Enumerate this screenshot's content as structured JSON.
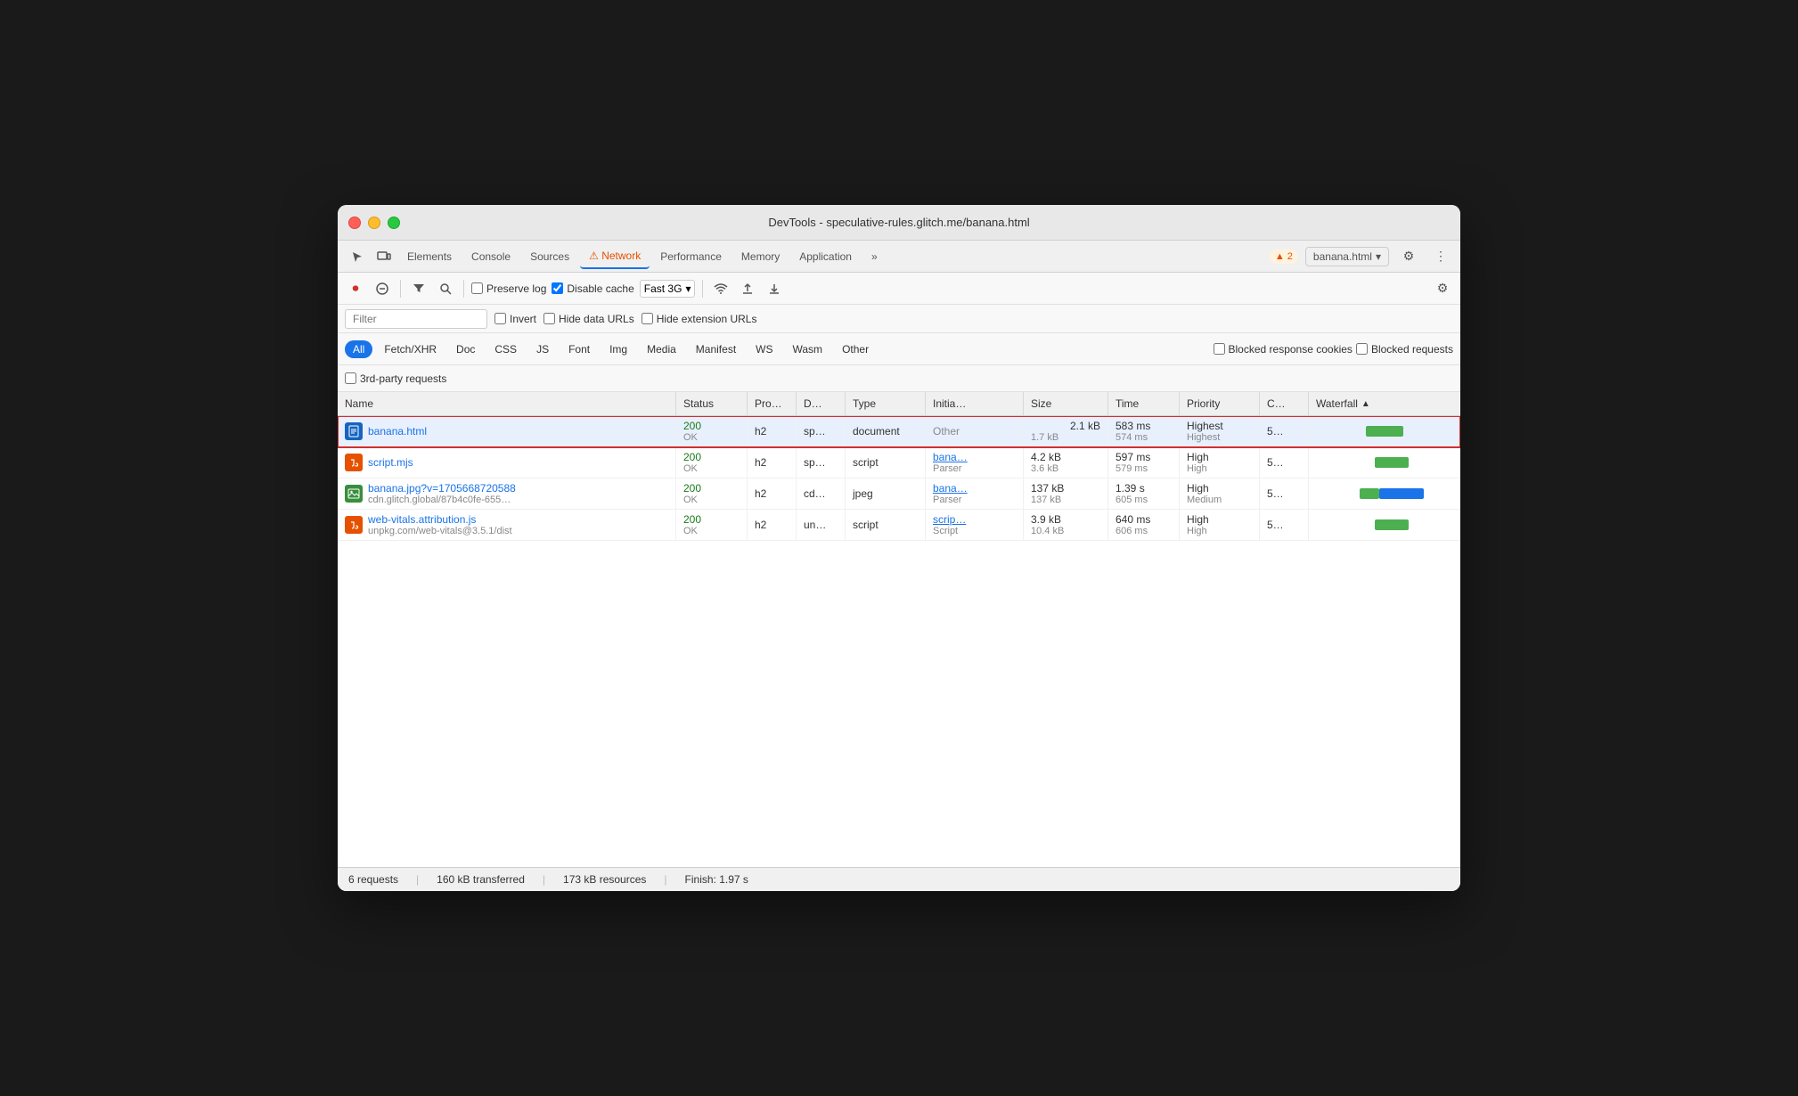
{
  "window": {
    "title": "DevTools - speculative-rules.glitch.me/banana.html"
  },
  "tabs": {
    "items": [
      {
        "label": "Elements",
        "active": false
      },
      {
        "label": "Console",
        "active": false
      },
      {
        "label": "Sources",
        "active": false
      },
      {
        "label": "⚠ Network",
        "active": true
      },
      {
        "label": "Performance",
        "active": false
      },
      {
        "label": "Memory",
        "active": false
      },
      {
        "label": "Application",
        "active": false
      },
      {
        "label": "»",
        "active": false
      }
    ],
    "warning_count": "▲ 2",
    "active_page": "banana.html",
    "settings_icon": "⚙",
    "more_icon": "⋮"
  },
  "toolbar": {
    "record_icon": "⏺",
    "clear_icon": "🚫",
    "filter_icon": "▼",
    "search_icon": "🔍",
    "preserve_log_label": "Preserve log",
    "disable_cache_label": "Disable cache",
    "network_throttle": "Fast 3G",
    "wifi_icon": "wifi",
    "upload_icon": "↑",
    "download_icon": "↓",
    "settings_icon": "⚙"
  },
  "filter": {
    "placeholder": "Filter",
    "invert_label": "Invert",
    "hide_data_urls_label": "Hide data URLs",
    "hide_ext_urls_label": "Hide extension URLs"
  },
  "type_filters": {
    "items": [
      "All",
      "Fetch/XHR",
      "Doc",
      "CSS",
      "JS",
      "Font",
      "Img",
      "Media",
      "Manifest",
      "WS",
      "Wasm",
      "Other"
    ],
    "active": "All",
    "blocked_response_cookies": "Blocked response cookies",
    "blocked_requests": "Blocked requests"
  },
  "third_party": {
    "label": "3rd-party requests"
  },
  "table": {
    "columns": [
      "Name",
      "Status",
      "Pro…",
      "D…",
      "Type",
      "Initia…",
      "Size",
      "Time",
      "Priority",
      "C…",
      "Waterfall"
    ],
    "rows": [
      {
        "name": "banana.html",
        "sub": "",
        "icon_type": "html",
        "status": "200",
        "status_text": "OK",
        "protocol": "h2",
        "domain": "sp…",
        "type": "document",
        "initiator": "Other",
        "initiator_sub": "",
        "size1": "2.1 kB",
        "size2": "1.7 kB",
        "time1": "583 ms",
        "time2": "574 ms",
        "priority": "Highest",
        "priority2": "Highest",
        "c": "5…",
        "selected": true,
        "waterfall": {
          "wait": 0,
          "green": 40,
          "blue": 0
        }
      },
      {
        "name": "script.mjs",
        "sub": "",
        "icon_type": "js",
        "status": "200",
        "status_text": "OK",
        "protocol": "h2",
        "domain": "sp…",
        "type": "script",
        "initiator": "bana…",
        "initiator_sub": "Parser",
        "size1": "4.2 kB",
        "size2": "3.6 kB",
        "time1": "597 ms",
        "time2": "579 ms",
        "priority": "High",
        "priority2": "High",
        "c": "5…",
        "selected": false,
        "waterfall": {
          "wait": 4,
          "green": 38,
          "blue": 0
        }
      },
      {
        "name": "banana.jpg?v=1705668720588",
        "sub": "cdn.glitch.global/87b4c0fe-655…",
        "icon_type": "img",
        "status": "200",
        "status_text": "OK",
        "protocol": "h2",
        "domain": "cd…",
        "type": "jpeg",
        "initiator": "bana…",
        "initiator_sub": "Parser",
        "size1": "137 kB",
        "size2": "137 kB",
        "time1": "1.39 s",
        "time2": "605 ms",
        "priority": "High",
        "priority2": "Medium",
        "c": "5…",
        "selected": false,
        "waterfall": {
          "wait": 4,
          "green": 22,
          "blue": 55
        }
      },
      {
        "name": "web-vitals.attribution.js",
        "sub": "unpkg.com/web-vitals@3.5.1/dist",
        "icon_type": "js",
        "status": "200",
        "status_text": "OK",
        "protocol": "h2",
        "domain": "un…",
        "type": "script",
        "initiator": "scrip…",
        "initiator_sub": "Script",
        "size1": "3.9 kB",
        "size2": "10.4 kB",
        "time1": "640 ms",
        "time2": "606 ms",
        "priority": "High",
        "priority2": "High",
        "c": "5…",
        "selected": false,
        "waterfall": {
          "wait": 4,
          "green": 38,
          "blue": 0
        }
      }
    ]
  },
  "status_bar": {
    "requests": "6 requests",
    "transferred": "160 kB transferred",
    "resources": "173 kB resources",
    "finish": "Finish: 1.97 s"
  }
}
